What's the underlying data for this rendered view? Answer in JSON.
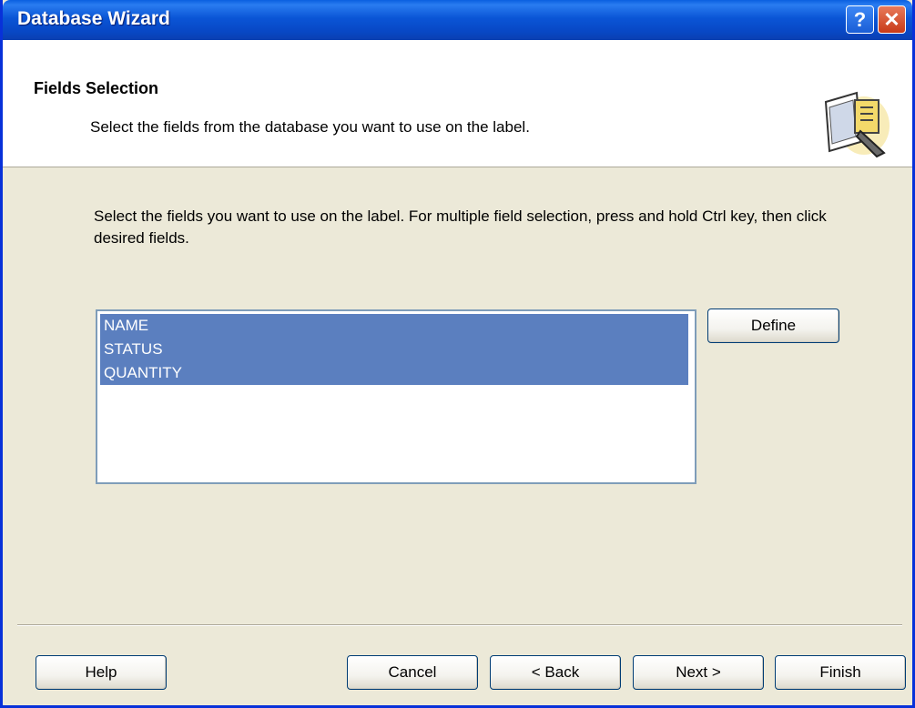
{
  "window": {
    "title": "Database Wizard",
    "help_glyph": "?",
    "close_glyph": "✕"
  },
  "header": {
    "title": "Fields Selection",
    "subtitle": "Select the fields from the database you want to use on the label.",
    "icon": "wizard-icon"
  },
  "main": {
    "instructions": "Select the fields you want to use on the label. For multiple field selection, press and hold Ctrl key, then click desired fields.",
    "fields": [
      "NAME",
      "STATUS",
      "QUANTITY"
    ],
    "define_label": "Define"
  },
  "footer": {
    "help_label": "Help",
    "cancel_label": "Cancel",
    "back_label": "< Back",
    "next_label": "Next >",
    "finish_label": "Finish"
  },
  "colors": {
    "titlebar": "#0a55d6",
    "selection": "#5b7fbf",
    "dialog_bg": "#ece9d8"
  }
}
